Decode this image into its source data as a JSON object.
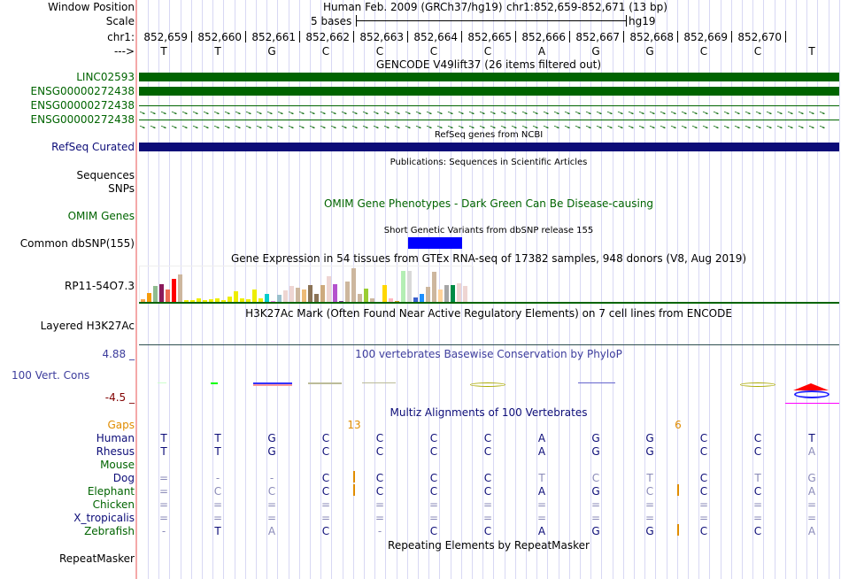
{
  "header": {
    "window_position_label": "Window Position",
    "assembly": "Human Feb. 2009 (GRCh37/hg19)",
    "position": "chr1:852,659-852,671 (13 bp)",
    "scale_label": "Scale",
    "scale_text": "5 bases",
    "scale_db": "hg19",
    "chrom_label": "chr1:",
    "strand_label": "--->"
  },
  "ruler": {
    "positions": [
      "852,659",
      "852,660",
      "852,661",
      "852,662",
      "852,663",
      "852,664",
      "852,665",
      "852,666",
      "852,667",
      "852,668",
      "852,669",
      "852,670"
    ],
    "bases": [
      "T",
      "T",
      "G",
      "C",
      "C",
      "C",
      "C",
      "A",
      "G",
      "G",
      "C",
      "C",
      "T"
    ]
  },
  "tracks": {
    "gencode": {
      "title": "GENCODE V49lift37 (26 items filtered out)",
      "items": [
        "LINC02593",
        "ENSG00000272438",
        "ENSG00000272438",
        "ENSG00000272438"
      ]
    },
    "refseq": {
      "title": "RefSeq genes from NCBI",
      "label": "RefSeq Curated"
    },
    "publications": {
      "title": "Publications: Sequences in Scientific Articles",
      "label": "Sequences"
    },
    "snps": {
      "label": "SNPs"
    },
    "omim": {
      "title": "OMIM Gene Phenotypes - Dark Green Can Be Disease-causing",
      "label": "OMIM Genes"
    },
    "dbsnp": {
      "title": "Short Genetic Variants from dbSNP release 155",
      "label": "Common dbSNP(155)"
    },
    "gtex": {
      "title": "Gene Expression in 54 tissues from GTEx RNA-seq of 17382 samples, 948 donors (V8, Aug 2019)",
      "label": "RP11-54O7.3",
      "values": [
        5,
        12,
        20,
        23,
        16,
        29,
        34,
        4,
        4,
        6,
        4,
        5,
        6,
        4,
        8,
        14,
        6,
        5,
        16,
        6,
        11,
        3,
        10,
        15,
        20,
        18,
        16,
        22,
        11,
        22,
        32,
        23,
        3,
        26,
        41,
        11,
        17,
        6,
        1,
        22,
        6,
        3,
        38,
        38,
        7,
        11,
        19,
        37,
        16,
        22,
        22,
        24,
        21,
        1
      ],
      "colors": [
        "#f7a449",
        "#f59b0a",
        "#8fbc8f",
        "#8b1a5b",
        "#ee6a50",
        "#ff0000",
        "#cdb79e",
        "#eeee00",
        "#eeee00",
        "#eeee00",
        "#eeee00",
        "#eeee00",
        "#eeee00",
        "#eeee00",
        "#eeee00",
        "#eeee00",
        "#eeee00",
        "#eeee00",
        "#eeee00",
        "#eeee00",
        "#00cdcd",
        "#ee82ee",
        "#9ac0cd",
        "#eed5d2",
        "#eed5d2",
        "#cdb79e",
        "#eebb77",
        "#8b7355",
        "#8b7355",
        "#cdaa7d",
        "#eed5d2",
        "#b452cd",
        "#7a378b",
        "#cdb79e",
        "#cdb79e",
        "#cdb79e",
        "#9acd32",
        "#cdb79e",
        "#3a5fcd",
        "#ffd700",
        "#ffb6c1",
        "#cd9b1d",
        "#b4eeb4",
        "#d9d9d9",
        "#3a5fcd",
        "#1e90ff",
        "#cdb79e",
        "#cdb79e",
        "#ffd39b",
        "#a6a6a6",
        "#008b45",
        "#eed5d2",
        "#eed5d2",
        "#eed5d2"
      ]
    },
    "h3k27ac": {
      "title": "H3K27Ac Mark (Often Found Near Active Regulatory Elements) on 7 cell lines from ENCODE",
      "label": "Layered H3K27Ac"
    },
    "phylop": {
      "title": "100 vertebrates Basewise Conservation by PhyloP",
      "label": "100 Vert. Cons",
      "max": "4.88 _",
      "min": "-4.5 _"
    },
    "multiz": {
      "title": "Multiz Alignments of 100 Vertebrates",
      "gaps_label": "Gaps",
      "gap_counts": [
        "13",
        "6"
      ],
      "species": [
        {
          "name": "Human",
          "color": "#0c0c78",
          "bases": [
            "T",
            "T",
            "G",
            "C",
            "C",
            "C",
            "C",
            "A",
            "G",
            "G",
            "C",
            "C",
            "T"
          ],
          "mismatch": []
        },
        {
          "name": "Rhesus",
          "color": "#0c0c78",
          "bases": [
            "T",
            "T",
            "G",
            "C",
            "C",
            "C",
            "C",
            "A",
            "G",
            "G",
            "C",
            "C",
            "A"
          ],
          "mismatch": [
            12
          ]
        },
        {
          "name": "Mouse",
          "color": "#006400",
          "bases": [],
          "mismatch": []
        },
        {
          "name": "Dog",
          "color": "#0c0c78",
          "bases": [
            "=",
            "-",
            "-",
            "C",
            "C",
            "C",
            "C",
            "T",
            "C",
            "T",
            "C",
            "T",
            "G"
          ],
          "mismatch": [
            0,
            1,
            2,
            7,
            8,
            9,
            11,
            12
          ]
        },
        {
          "name": "Elephant",
          "color": "#006400",
          "bases": [
            "=",
            "C",
            "C",
            "C",
            "C",
            "C",
            "C",
            "A",
            "G",
            "C",
            "C",
            "C",
            "A"
          ],
          "mismatch": [
            0,
            1,
            2,
            9,
            12
          ]
        },
        {
          "name": "Chicken",
          "color": "#006400",
          "bases": [
            "=",
            "=",
            "=",
            "=",
            "=",
            "=",
            "=",
            "=",
            "=",
            "=",
            "=",
            "=",
            "="
          ],
          "mismatch": [
            0,
            1,
            2,
            3,
            4,
            5,
            6,
            7,
            8,
            9,
            10,
            11,
            12
          ]
        },
        {
          "name": "X_tropicalis",
          "color": "#0c0c78",
          "bases": [
            "=",
            "=",
            "=",
            "=",
            "=",
            "=",
            "=",
            "=",
            "=",
            "=",
            "=",
            "=",
            "="
          ],
          "mismatch": [
            0,
            1,
            2,
            3,
            4,
            5,
            6,
            7,
            8,
            9,
            10,
            11,
            12
          ]
        },
        {
          "name": "Zebrafish",
          "color": "#006400",
          "bases": [
            "-",
            "T",
            "A",
            "C",
            "-",
            "C",
            "C",
            "A",
            "G",
            "G",
            "C",
            "C",
            "A"
          ],
          "mismatch": [
            0,
            2,
            4,
            12
          ]
        }
      ]
    },
    "repeatmasker": {
      "title": "Repeating Elements by RepeatMasker",
      "label": "RepeatMasker"
    }
  }
}
